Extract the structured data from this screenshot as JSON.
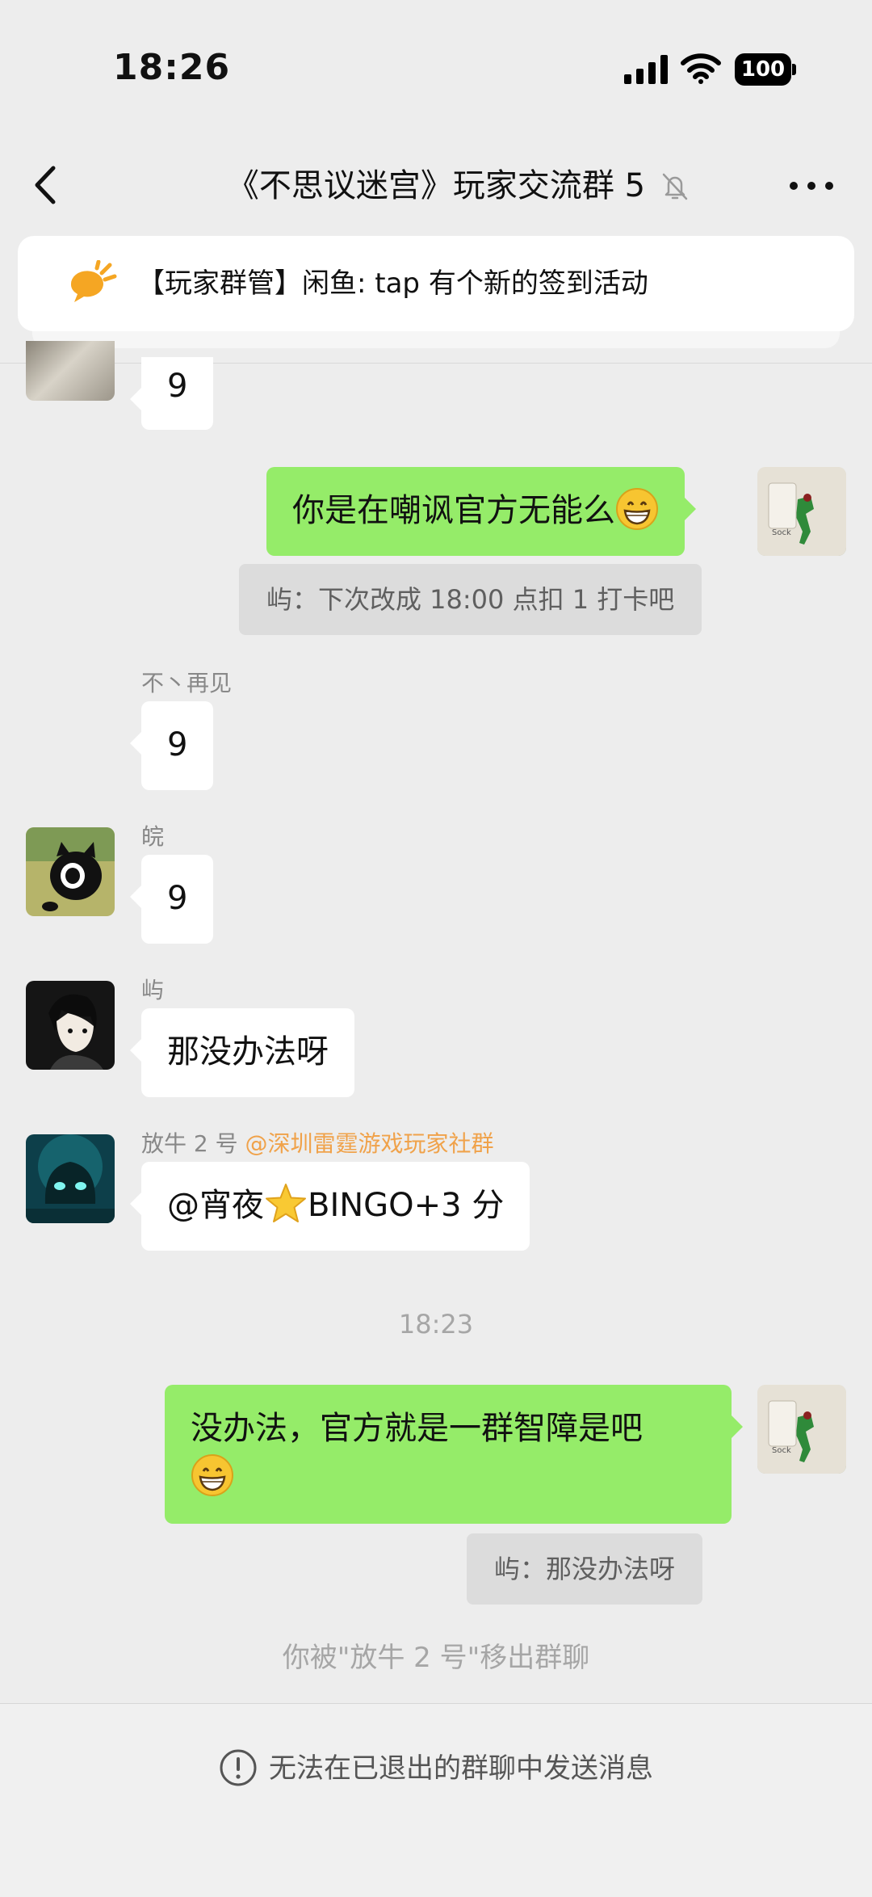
{
  "status_bar": {
    "time": "18:26",
    "battery": "100"
  },
  "nav": {
    "title": "《不思议迷宫》玩家交流群 5"
  },
  "announcement": {
    "text": "【玩家群管】闲鱼: tap 有个新的签到活动"
  },
  "messages": [
    {
      "type": "incoming",
      "sender": "",
      "text": "9"
    },
    {
      "type": "outgoing",
      "text": "你是在嘲讽官方无能么",
      "emoji": "grin",
      "quote": "屿：下次改成 18:00 点扣 1 打卡吧"
    },
    {
      "type": "incoming",
      "sender": "不丶再见",
      "text": "9"
    },
    {
      "type": "incoming",
      "sender": "皖",
      "text": "9"
    },
    {
      "type": "incoming",
      "sender": "屿",
      "text": "那没办法呀"
    },
    {
      "type": "incoming",
      "sender": "放牛 2 号",
      "sender_tag": "@深圳雷霆游戏玩家社群",
      "text_before": "@宵夜",
      "text_after": "BINGO+3 分",
      "emoji": "star"
    },
    {
      "type": "timestamp",
      "text": "18:23"
    },
    {
      "type": "outgoing",
      "text": "没办法，官方就是一群智障是吧",
      "emoji": "grin",
      "quote": "屿：那没办法呀"
    },
    {
      "type": "system",
      "text": "你被\"放牛 2 号\"移出群聊"
    }
  ],
  "footer": {
    "text": "无法在已退出的群聊中发送消息"
  },
  "colors": {
    "background": "#ededed",
    "outgoing_bubble": "#95ec69",
    "incoming_bubble": "#ffffff",
    "mention": "#f0a24a"
  }
}
